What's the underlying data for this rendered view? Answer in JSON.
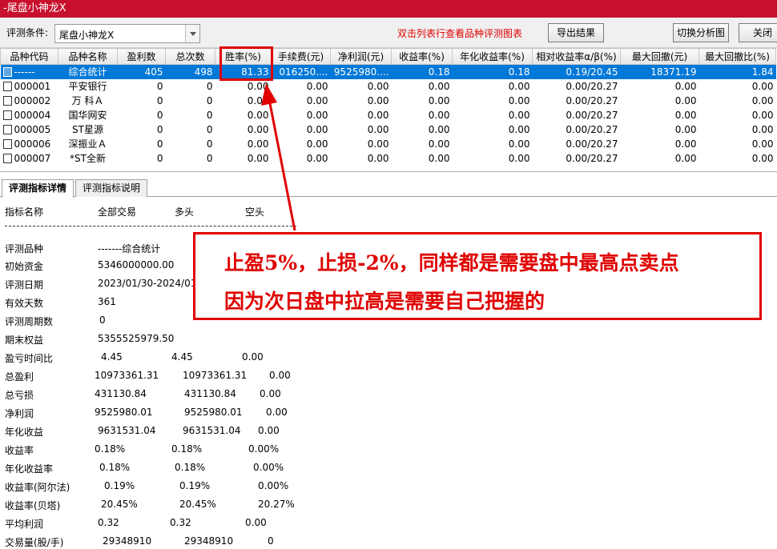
{
  "window": {
    "title": "-尾盘小神龙X"
  },
  "toolbar": {
    "condition_label": "评测条件:",
    "condition_value": "尾盘小神龙X",
    "hint": "双击列表行查看品种评测图表",
    "export_label": "导出结果",
    "switch_label": "切换分析图",
    "close_label": "关闭"
  },
  "table": {
    "headers": [
      "品种代码",
      "品种名称",
      "盈利数",
      "总次数",
      "胜率(%)",
      "手续费(元)",
      "净利润(元)",
      "收益率(%)",
      "年化收益率(%)",
      "相对收益率α/β(%)",
      "最大回撤(元)",
      "最大回撤比(%)"
    ],
    "rows": [
      [
        "------",
        "综合统计",
        "405",
        "498",
        "81.33",
        "016250....",
        "9525980....",
        "0.18",
        "0.18",
        "0.19/20.45",
        "18371.19",
        "1.84"
      ],
      [
        "000001",
        "平安银行",
        "0",
        "0",
        "0.00",
        "0.00",
        "0.00",
        "0.00",
        "0.00",
        "0.00/20.27",
        "0.00",
        "0.00"
      ],
      [
        "000002",
        "万 科Ａ",
        "0",
        "0",
        "0.00",
        "0.00",
        "0.00",
        "0.00",
        "0.00",
        "0.00/20.27",
        "0.00",
        "0.00"
      ],
      [
        "000004",
        "国华网安",
        "0",
        "0",
        "0.00",
        "0.00",
        "0.00",
        "0.00",
        "0.00",
        "0.00/20.27",
        "0.00",
        "0.00"
      ],
      [
        "000005",
        "ST星源",
        "0",
        "0",
        "0.00",
        "0.00",
        "0.00",
        "0.00",
        "0.00",
        "0.00/20.27",
        "0.00",
        "0.00"
      ],
      [
        "000006",
        "深振业Ａ",
        "0",
        "0",
        "0.00",
        "0.00",
        "0.00",
        "0.00",
        "0.00",
        "0.00/20.27",
        "0.00",
        "0.00"
      ],
      [
        "000007",
        "*ST全新",
        "0",
        "0",
        "0.00",
        "0.00",
        "0.00",
        "0.00",
        "0.00",
        "0.00/20.27",
        "0.00",
        "0.00"
      ]
    ]
  },
  "tabs": [
    {
      "label": "评测指标详情"
    },
    {
      "label": "评测指标说明"
    }
  ],
  "detail": {
    "headers": [
      "指标名称",
      "全部交易",
      "多头",
      "空头"
    ],
    "rows": [
      {
        "name": "评测品种",
        "all": "-------综合统计",
        "long": "",
        "short": ""
      },
      {
        "name": "初始资金",
        "all": "5346000000.00",
        "long": "",
        "short": ""
      },
      {
        "name": "评测日期",
        "all": "2023/01/30-2024/01/26",
        "long": "",
        "short": ""
      },
      {
        "name": "有效天数",
        "all": "361",
        "long": "",
        "short": ""
      },
      {
        "name": "评测周期数",
        "all": "0",
        "long": "",
        "short": ""
      },
      {
        "name": "期末权益",
        "all": "5355525979.50",
        "long": "",
        "short": ""
      },
      {
        "name": "盈亏时间比",
        "all": "4.45",
        "long": "4.45",
        "short": "0.00"
      },
      {
        "name": "总盈利",
        "all": "10973361.31",
        "long": "10973361.31",
        "short": "0.00"
      },
      {
        "name": "总亏损",
        "all": "431130.84",
        "long": "431130.84",
        "short": "0.00"
      },
      {
        "name": "净利润",
        "all": "9525980.01",
        "long": "9525980.01",
        "short": "0.00"
      },
      {
        "name": "年化收益",
        "all": "9631531.04",
        "long": "9631531.04",
        "short": "0.00"
      },
      {
        "name": "收益率",
        "all": "0.18%",
        "long": "0.18%",
        "short": "0.00%"
      },
      {
        "name": "年化收益率",
        "all": "0.18%",
        "long": "0.18%",
        "short": "0.00%"
      },
      {
        "name": "收益率(阿尔法)",
        "all": "0.19%",
        "long": "0.19%",
        "short": "0.00%"
      },
      {
        "name": "收益率(贝塔)",
        "all": "20.45%",
        "long": "20.45%",
        "short": "20.27%"
      },
      {
        "name": "平均利润",
        "all": "0.32",
        "long": "0.32",
        "short": "0.00"
      },
      {
        "name": "交易量(股/手)",
        "all": "29348910",
        "long": "29348910",
        "short": "0"
      }
    ]
  },
  "annotation": {
    "line1": "止盈5%，止损-2%，同样都是需要盘中最高点卖点",
    "line2": "因为次日盘中拉高是需要自己把握的",
    "color": "#e00000"
  }
}
